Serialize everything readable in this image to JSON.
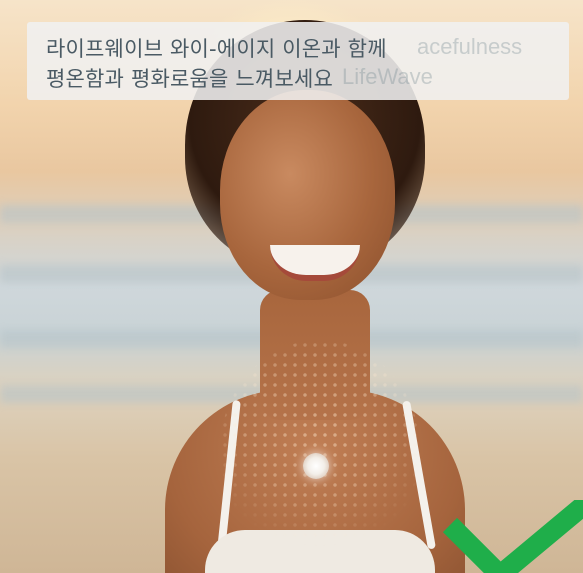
{
  "overlay": {
    "line1": "라이프웨이브 와이-에이지 이온과 함께",
    "line2": "평온함과 평화로움을 느껴보세요",
    "ghost_right_1": "acefulness",
    "ghost_right_2": "LifeWave"
  },
  "image": {
    "subject": "smiling woman at beach with glowing patch",
    "icons": [
      "check-mark-icon"
    ]
  },
  "colors": {
    "caption_text": "#4a5a64",
    "check_green": "#1fae4a"
  }
}
